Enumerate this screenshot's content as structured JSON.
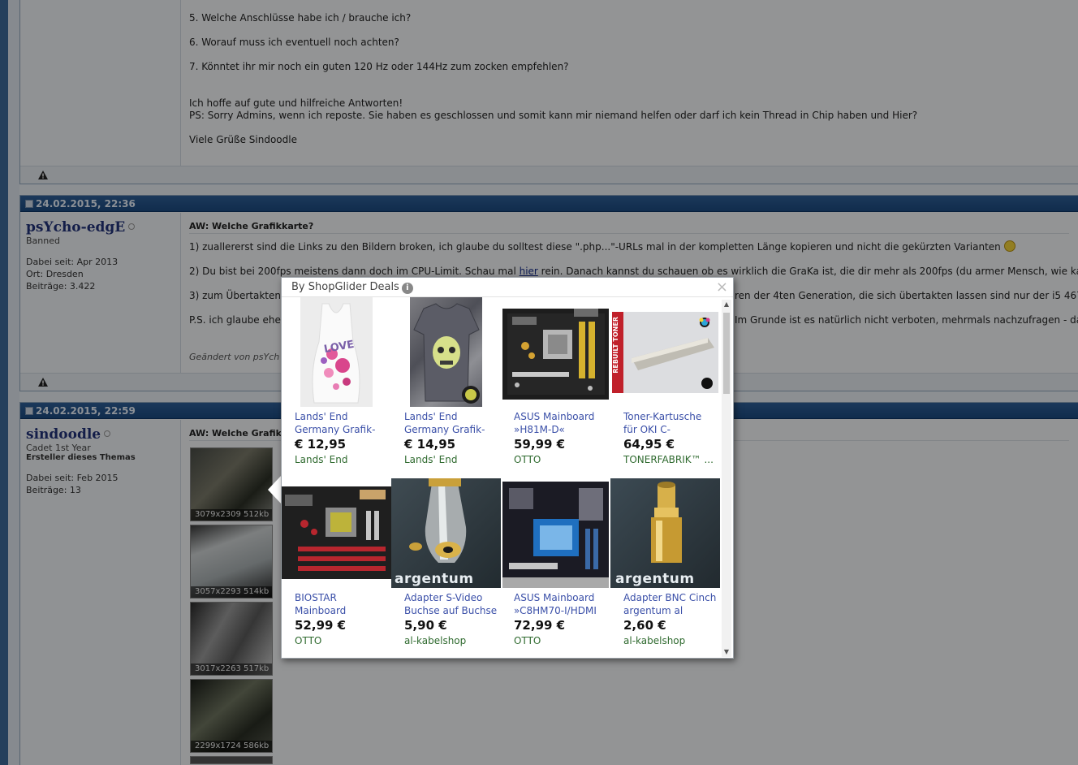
{
  "post1": {
    "lines": [
      "5. Welche Anschlüsse habe ich / brauche ich?",
      "6. Worauf muss ich eventuell noch achten?",
      "7. Könntet ihr mir noch ein guten 120 Hz oder 144Hz zum zocken empfehlen?",
      "Ich hoffe auf gute und hilfreiche Antworten!",
      "PS: Sorry Admins, wenn ich reposte. Sie haben es geschlossen und somit kann mir niemand helfen oder darf ich kein Thread in Chip haben und Hier?",
      "Viele Grüße Sindoodle"
    ]
  },
  "post2": {
    "date": "24.02.2015, 22:36",
    "username": "psYcho-edgE",
    "rank": "Banned",
    "joined": "Dabei seit: Apr 2013",
    "location": "Ort: Dresden",
    "posts": "Beiträge: 3.422",
    "title": "AW: Welche Grafikkarte?",
    "line1": "1) zuallererst sind die Links zu den Bildern broken, ich glaube du solltest diese \".php...\"-URLs mal in der kompletten Länge kopieren und nicht die gekürzten Varianten",
    "line2a": "2) Du bist bei 200fps meistens dann doch im CPU-Limit. Schau mal ",
    "line2link": "hier",
    "line2b": " rein. Danach kannst du schauen ob es wirklich die GraKa ist, die dir mehr als 200fps (du armer Mensch, wie ka",
    "line3a": "3) zum Übertakten",
    "line3b": "ren der 4ten Generation, die sich übertakten lassen sind nur der i5 467",
    "line4a": "P.S. ich glaube ehe",
    "line4b": "Im Grunde ist es natürlich nicht verboten, mehrmals nachzufragen - da",
    "edited": "Geändert von psYch"
  },
  "post3": {
    "date": "24.02.2015, 22:59",
    "username": "sindoodle",
    "rank": "Cadet 1st Year",
    "starter": "Ersteller dieses Themas",
    "joined": "Dabei seit: Feb 2015",
    "posts": "Beiträge: 13",
    "title": "AW: Welche Grafik",
    "thumbs": [
      "3079x2309 512kb",
      "3057x2293 514kb",
      "3017x2263 517kb",
      "2299x1724 586kb"
    ]
  },
  "popup": {
    "header": "By ShopGlider Deals",
    "info_icon": "i",
    "close": "×",
    "products": [
      {
        "title": "Lands' End Germany Grafik-",
        "price": "€ 12,95",
        "shop": "Lands' End"
      },
      {
        "title": "Lands' End Germany Grafik-",
        "price": "€ 14,95",
        "shop": "Lands' End"
      },
      {
        "title": "ASUS Mainboard »H81M-D«",
        "price": "59,99 €",
        "shop": "OTTO"
      },
      {
        "title": "Toner-Kartusche für OKI C-",
        "price": "64,95 €",
        "shop": "TONERFABRIK™ ..."
      },
      {
        "title": "BIOSTAR Mainboard",
        "price": "52,99 €",
        "shop": "OTTO"
      },
      {
        "title": "Adapter S-Video Buchse auf Buchse",
        "price": "5,90 €",
        "shop": "al-kabelshop"
      },
      {
        "title": "ASUS Mainboard »C8HM70-I/HDMI",
        "price": "72,99 €",
        "shop": "OTTO"
      },
      {
        "title": "Adapter BNC Cinch argentum al",
        "price": "2,60 €",
        "shop": "al-kabelshop"
      }
    ],
    "img_text": {
      "argentum": "argentum",
      "rebuilt": "REBUILT TONER",
      "love": "LOVE"
    }
  }
}
